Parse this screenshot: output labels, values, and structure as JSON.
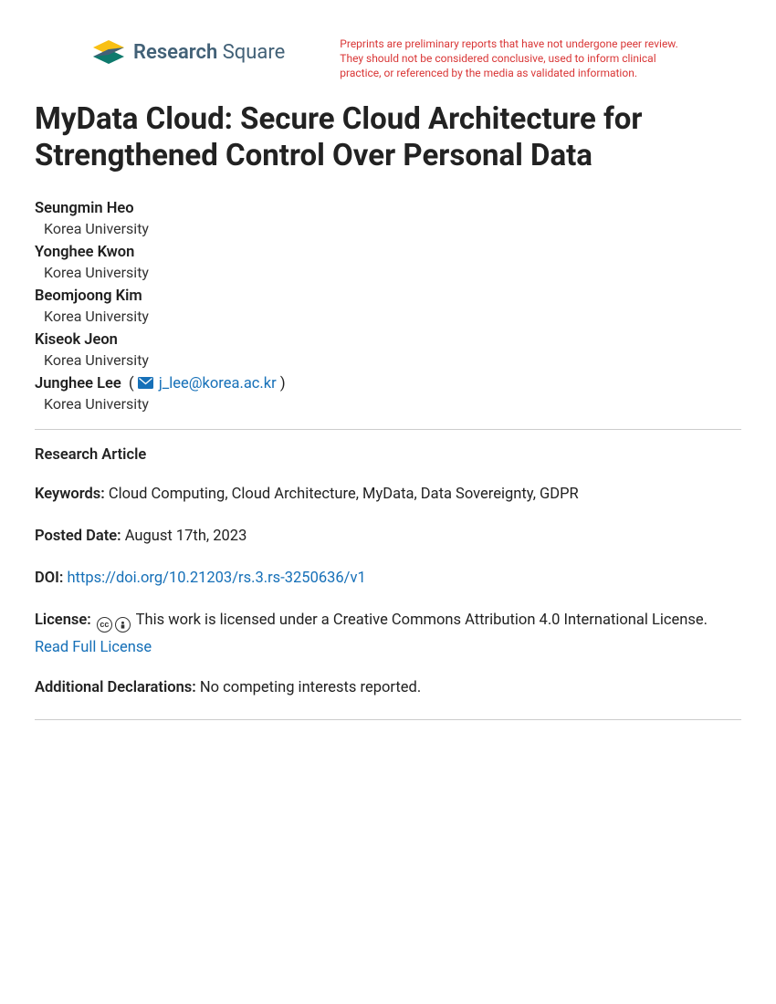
{
  "brand": {
    "name_bold": "Research",
    "name_light": "Square"
  },
  "disclaimer": "Preprints are preliminary reports that have not undergone peer review. They should not be considered conclusive, used to inform clinical practice, or referenced by the media as validated information.",
  "title": "MyData Cloud: Secure Cloud Architecture for Strengthened Control Over Personal Data",
  "authors": [
    {
      "name": "Seungmin Heo",
      "affiliation": "Korea University"
    },
    {
      "name": "Yonghee Kwon",
      "affiliation": "Korea University"
    },
    {
      "name": "Beomjoong Kim",
      "affiliation": "Korea University"
    },
    {
      "name": "Kiseok Jeon",
      "affiliation": "Korea University"
    },
    {
      "name": "Junghee Lee",
      "affiliation": "Korea University",
      "email": "j_lee@korea.ac.kr"
    }
  ],
  "article_type": "Research Article",
  "keywords_label": "Keywords:",
  "keywords": "Cloud Computing, Cloud Architecture, MyData, Data Sovereignty, GDPR",
  "posted_label": "Posted Date:",
  "posted_date": "August 17th, 2023",
  "doi_label": "DOI:",
  "doi": "https://doi.org/10.21203/rs.3.rs-3250636/v1",
  "license_label": "License:",
  "license_text": "This work is licensed under a Creative Commons Attribution 4.0 International License.",
  "license_read": "Read Full License",
  "declarations_label": "Additional Declarations:",
  "declarations_text": "No competing interests reported."
}
